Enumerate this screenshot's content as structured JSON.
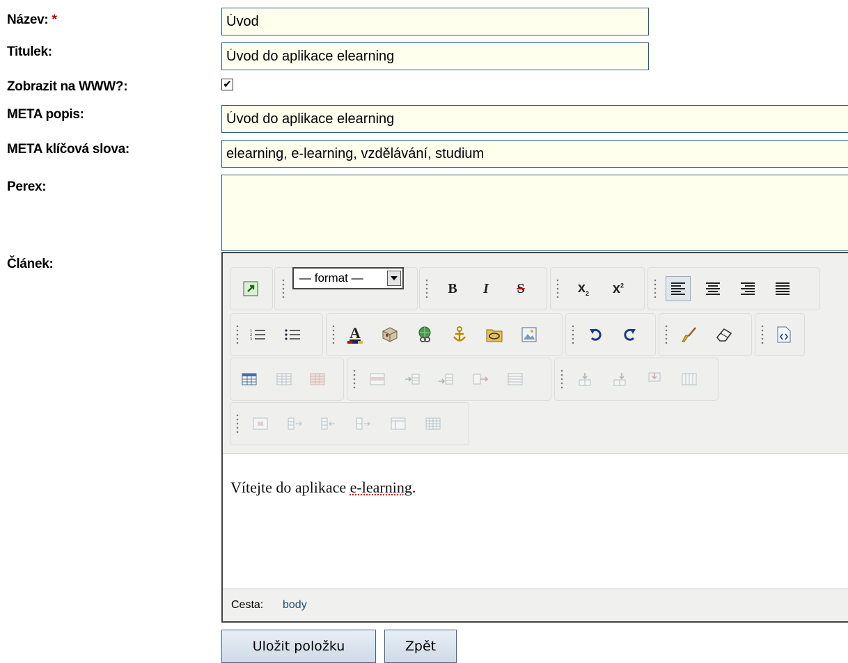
{
  "form": {
    "name": {
      "label": "Název:",
      "required_mark": "*",
      "value": "Úvod"
    },
    "title": {
      "label": "Titulek:",
      "value": "Úvod do aplikace elearning"
    },
    "show_www": {
      "label": "Zobrazit na WWW?:",
      "checked": true,
      "check_glyph": "✔"
    },
    "meta_description": {
      "label": "META popis:",
      "value": "Úvod do aplikace elearning"
    },
    "meta_keywords": {
      "label": "META klíčová slova:",
      "value": "elearning, e-learning, vzdělávání, studium"
    },
    "perex": {
      "label": "Perex:",
      "value": ""
    },
    "article": {
      "label": "Článek:"
    }
  },
  "editor": {
    "format_select": {
      "selected": "— format —"
    },
    "toolbar_icons": [
      "fullscreen-icon",
      "bold-icon",
      "italic-icon",
      "strikethrough-icon",
      "subscript-icon",
      "superscript-icon",
      "align-left-icon",
      "align-center-icon",
      "align-right-icon",
      "align-justify-icon",
      "ordered-list-icon",
      "unordered-list-icon",
      "text-color-icon",
      "media-icon",
      "link-icon",
      "anchor-icon",
      "file-icon",
      "image-icon",
      "undo-icon",
      "redo-icon",
      "cleanup-icon",
      "eraser-icon",
      "source-code-icon",
      "table-icon",
      "table-props-icon",
      "table-delete-icon",
      "row-props-icon",
      "row-insert-before-icon",
      "row-insert-after-icon",
      "row-delete-icon",
      "table-split-icon",
      "col-insert-before-icon",
      "col-insert-after-icon",
      "col-delete-icon",
      "table-merge-icon",
      "cell-props-icon",
      "cell-insert-icon",
      "cell-merge-icon",
      "cell-split-icon",
      "table-grid-icon"
    ],
    "glyphs": {
      "bold": "B",
      "italic": "I",
      "strike": "S",
      "subscript": "x",
      "superscript": "x",
      "sub2": "2",
      "sup2": "2",
      "text_color": "A"
    },
    "content": {
      "text_before": "Vítejte do aplikace ",
      "text_misspelled": "e-learning",
      "text_after": "."
    },
    "statusbar": {
      "path_label": "Cesta:",
      "path_value": "body"
    }
  },
  "buttons": {
    "save": "Uložit položku",
    "back": "Zpět"
  },
  "colors": {
    "input_bg": "#ffffee",
    "input_border": "#2e5a7c",
    "required": "#cc0000",
    "toolbar_bg": "#f0f0ee"
  }
}
